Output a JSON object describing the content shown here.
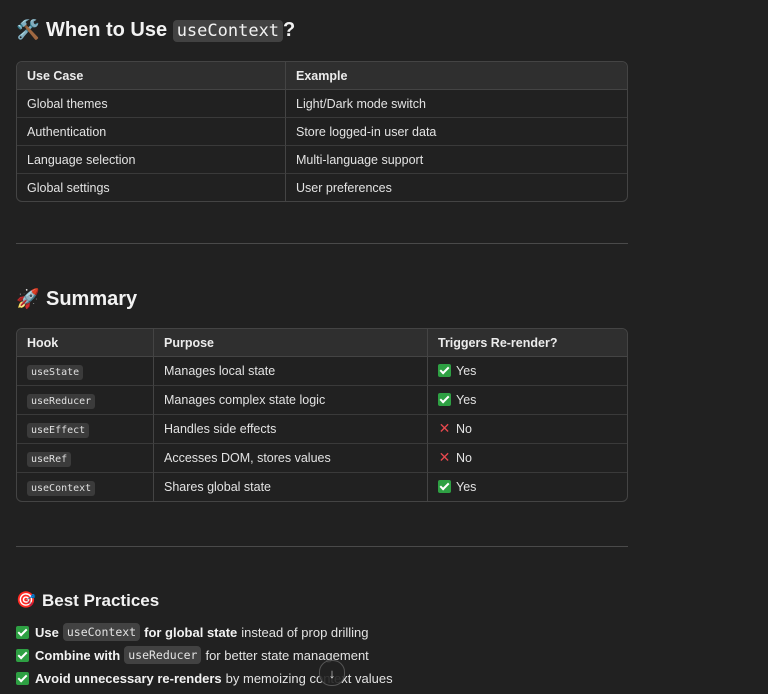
{
  "when": {
    "title_prefix": "When to Use",
    "title_code": "useContext",
    "title_suffix": "?",
    "icon": "hammer-and-wrench-icon",
    "emoji": "🛠️",
    "headers": [
      "Use Case",
      "Example"
    ],
    "rows": [
      [
        "Global themes",
        "Light/Dark mode switch"
      ],
      [
        "Authentication",
        "Store logged-in user data"
      ],
      [
        "Language selection",
        "Multi-language support"
      ],
      [
        "Global settings",
        "User preferences"
      ]
    ]
  },
  "summary": {
    "title": "Summary",
    "icon": "rocket-icon",
    "emoji": "🚀",
    "headers": [
      "Hook",
      "Purpose",
      "Triggers Re-render?"
    ],
    "rows": [
      {
        "hook": "useState",
        "purpose": "Manages local state",
        "rerender": "Yes",
        "mark": "check"
      },
      {
        "hook": "useReducer",
        "purpose": "Manages complex state logic",
        "rerender": "Yes",
        "mark": "check"
      },
      {
        "hook": "useEffect",
        "purpose": "Handles side effects",
        "rerender": "No",
        "mark": "cross"
      },
      {
        "hook": "useRef",
        "purpose": "Accesses DOM, stores values",
        "rerender": "No",
        "mark": "cross"
      },
      {
        "hook": "useContext",
        "purpose": "Shares global state",
        "rerender": "Yes",
        "mark": "check"
      }
    ]
  },
  "best": {
    "title": "Best Practices",
    "icon": "target-icon",
    "emoji": "🎯",
    "items": [
      {
        "bold1": "Use",
        "code": "useContext",
        "bold2": "for global state",
        "rest": "instead of prop drilling"
      },
      {
        "bold1": "Combine with",
        "code": "useReducer",
        "bold2": "",
        "rest": "for better state management"
      },
      {
        "bold1": "Avoid unnecessary re-renders",
        "code": "",
        "bold2": "",
        "rest": "by memoizing context values"
      }
    ]
  },
  "colors": {
    "background": "#212121",
    "check": "#2ea043",
    "cross": "#e5484d"
  }
}
